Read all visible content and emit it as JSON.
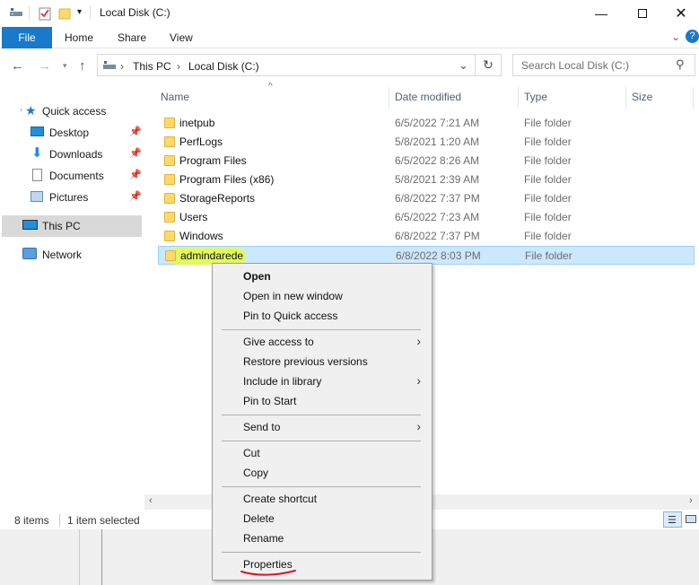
{
  "window": {
    "title": "Local Disk (C:)"
  },
  "ribbon": {
    "tabs": [
      "File",
      "Home",
      "Share",
      "View"
    ]
  },
  "address": {
    "crumbs": [
      "This PC",
      "Local Disk (C:)"
    ],
    "search_placeholder": "Search Local Disk (C:)"
  },
  "nav": {
    "quick_access": "Quick access",
    "desktop": "Desktop",
    "downloads": "Downloads",
    "documents": "Documents",
    "pictures": "Pictures",
    "this_pc": "This PC",
    "network": "Network"
  },
  "columns": {
    "name": "Name",
    "date": "Date modified",
    "type": "Type",
    "size": "Size"
  },
  "files": [
    {
      "name": "inetpub",
      "date": "6/5/2022 7:21 AM",
      "type": "File folder"
    },
    {
      "name": "PerfLogs",
      "date": "5/8/2021 1:20 AM",
      "type": "File folder"
    },
    {
      "name": "Program Files",
      "date": "6/5/2022 8:26 AM",
      "type": "File folder"
    },
    {
      "name": "Program Files (x86)",
      "date": "5/8/2021 2:39 AM",
      "type": "File folder"
    },
    {
      "name": "StorageReports",
      "date": "6/8/2022 7:37 PM",
      "type": "File folder"
    },
    {
      "name": "Users",
      "date": "6/5/2022 7:23 AM",
      "type": "File folder"
    },
    {
      "name": "Windows",
      "date": "6/8/2022 7:37 PM",
      "type": "File folder"
    },
    {
      "name": "admindarede",
      "date": "6/8/2022 8:03 PM",
      "type": "File folder"
    }
  ],
  "status": {
    "item_count": "8 items",
    "selected": "1 item selected"
  },
  "context_menu": {
    "open": "Open",
    "open_new_window": "Open in new window",
    "pin_quick_access": "Pin to Quick access",
    "give_access": "Give access to",
    "restore_versions": "Restore previous versions",
    "include_library": "Include in library",
    "pin_start": "Pin to Start",
    "send_to": "Send to",
    "cut": "Cut",
    "copy": "Copy",
    "create_shortcut": "Create shortcut",
    "delete": "Delete",
    "rename": "Rename",
    "properties": "Properties"
  },
  "colors": {
    "accent": "#1979ca",
    "selection": "#cce8ff",
    "highlight": "#e6fb44",
    "annotation": "#e0102a"
  }
}
